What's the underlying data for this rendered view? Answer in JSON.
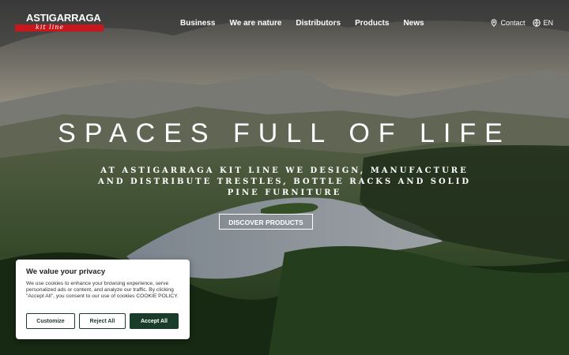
{
  "brand": {
    "name": "ASTIGARRAGA",
    "tagline": "kit line"
  },
  "nav": {
    "items": [
      "Business",
      "We are nature",
      "Distributors",
      "Products",
      "News"
    ]
  },
  "utils": {
    "contact": "Contact",
    "language": "EN"
  },
  "hero": {
    "headline": "SPACES FULL OF LIFE",
    "subline": "AT ASTIGARRAGA KIT LINE WE DESIGN, MANUFACTURE AND DISTRIBUTE TRESTLES, BOTTLE RACKS AND SOLID PINE FURNITURE",
    "cta": "DISCOVER PRODUCTS"
  },
  "cookie": {
    "title": "We value your privacy",
    "body": "We use cookies to enhance your browsing experience, serve personalized ads or content, and analyze our traffic. By clicking \"Accept All\", you consent to our use of cookies COOKIE POLICY.",
    "customize": "Customize",
    "reject": "Reject All",
    "accept": "Accept All"
  },
  "colors": {
    "brand_red": "#c8161d",
    "accept_green": "#193c2b"
  },
  "icons": {
    "contact": "location-pin-icon",
    "language": "globe-icon"
  }
}
